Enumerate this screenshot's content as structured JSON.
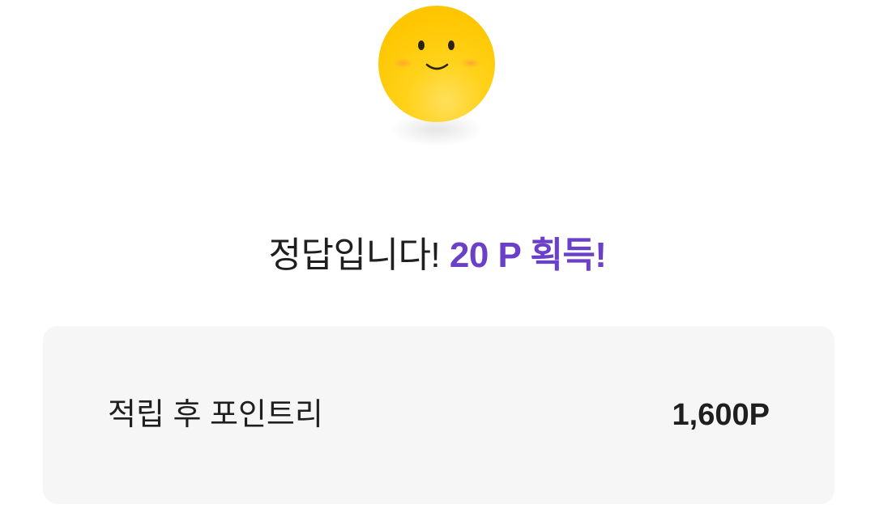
{
  "mascot": {
    "icon": "smiley-face-icon",
    "face_color": "#ffc700",
    "cheek_color": "#ff9e3d"
  },
  "result": {
    "message": "정답입니다!",
    "reward": "20 P 획득!",
    "accent_color": "#6a40c9"
  },
  "summary": {
    "label": "적립 후 포인트리",
    "value": "1,600P"
  }
}
